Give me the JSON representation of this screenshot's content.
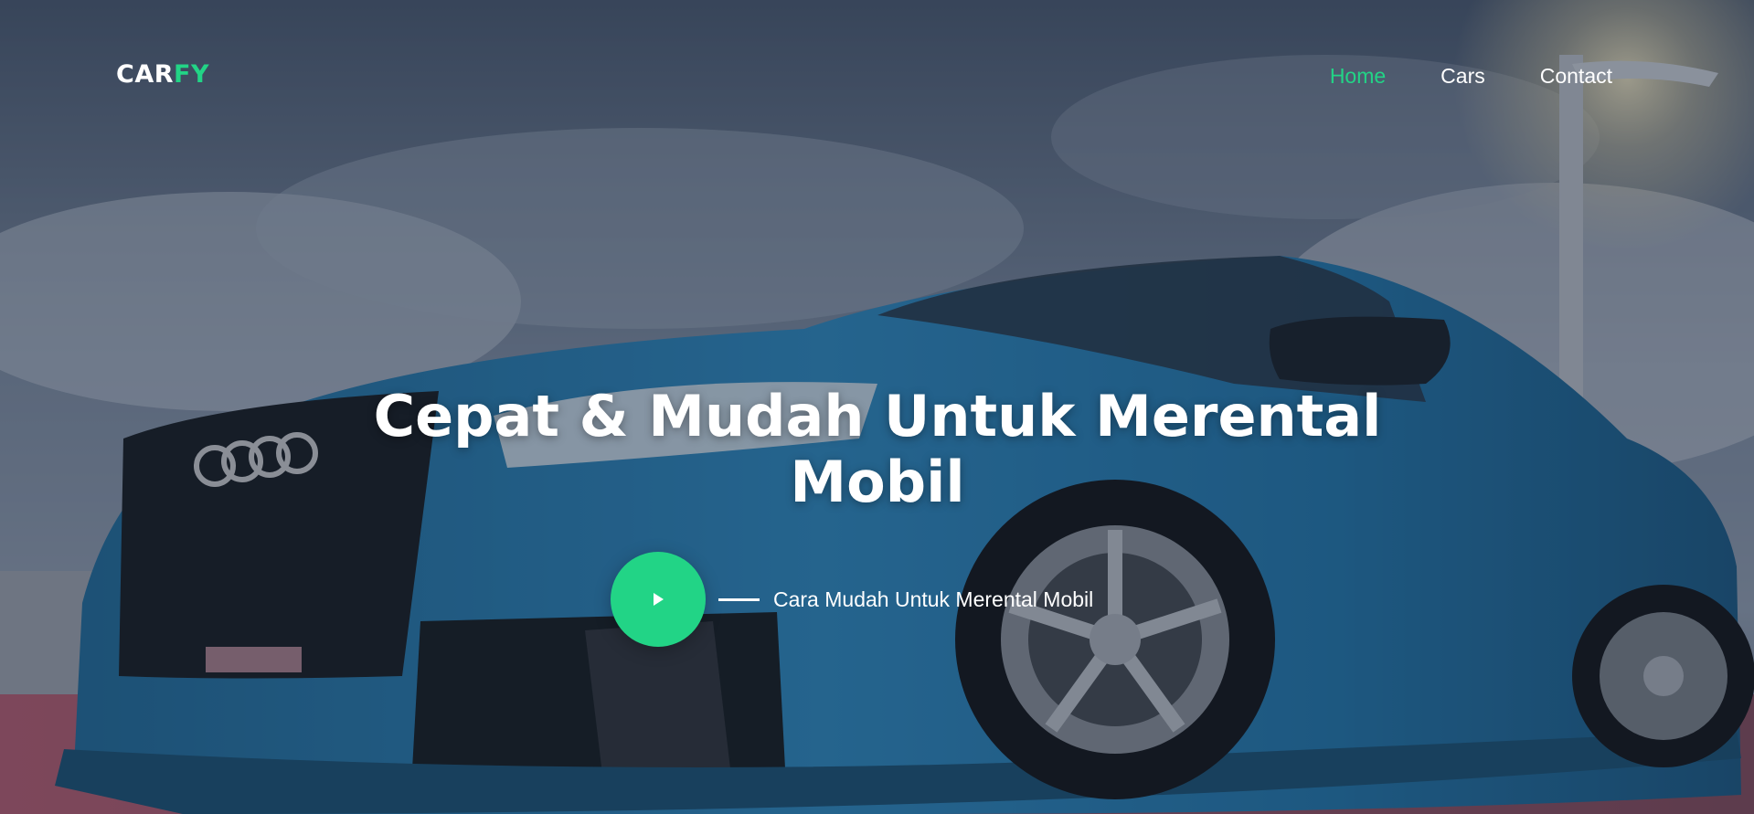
{
  "brand": {
    "prefix": "CAR",
    "accent": "FY",
    "accent_color": "#22d486"
  },
  "nav": {
    "items": [
      {
        "label": "Home",
        "active": true
      },
      {
        "label": "Cars",
        "active": false
      },
      {
        "label": "Contact",
        "active": false
      }
    ]
  },
  "hero": {
    "title": "Cepat & Mudah Untuk Merental Mobil",
    "cta_text": "Cara Mudah Untuk Merental Mobil",
    "cta_icon": "play-icon"
  }
}
